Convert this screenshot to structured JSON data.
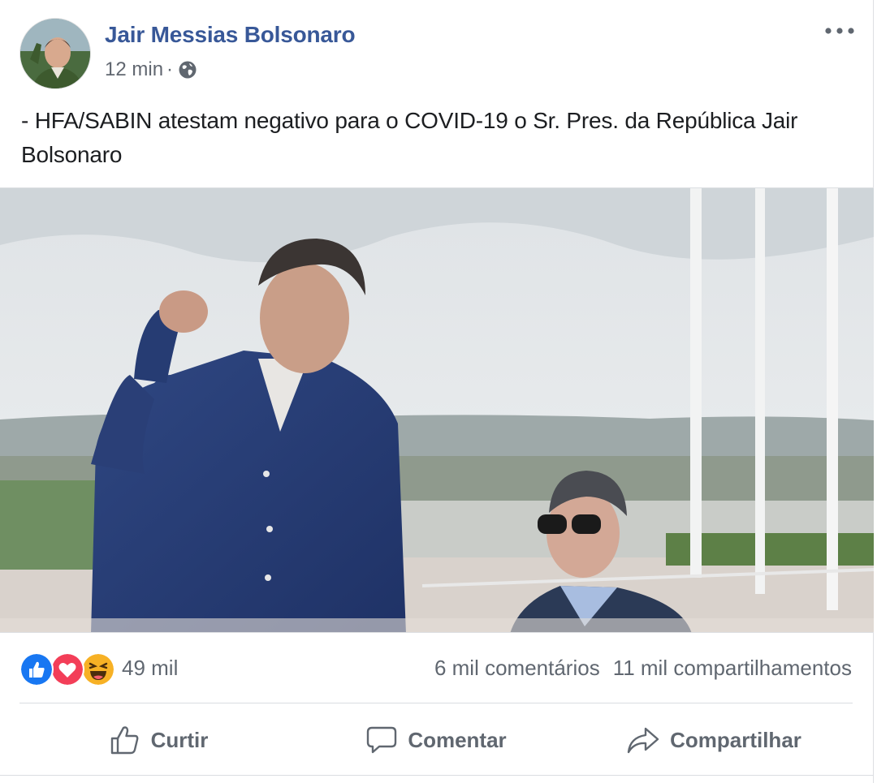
{
  "post": {
    "author": "Jair Messias Bolsonaro",
    "time": "12 min",
    "separator": "·",
    "audience_icon": "globe-icon",
    "text": "- HFA/SABIN atestam negativo para o COVID-19 o Sr. Pres. da República Jair Bolsonaro"
  },
  "reactions": {
    "icons": [
      "like-icon",
      "love-icon",
      "haha-icon"
    ],
    "count": "49 mil"
  },
  "stats": {
    "comments": "6 mil comentários",
    "shares": "11 mil compartilhamentos"
  },
  "actions": {
    "like": "Curtir",
    "comment": "Comentar",
    "share": "Compartilhar"
  },
  "colors": {
    "author_link": "#385898",
    "secondary_text": "#606770",
    "like_blue": "#1877f2",
    "love_red": "#f33e58",
    "haha_yellow": "#f7b125"
  }
}
